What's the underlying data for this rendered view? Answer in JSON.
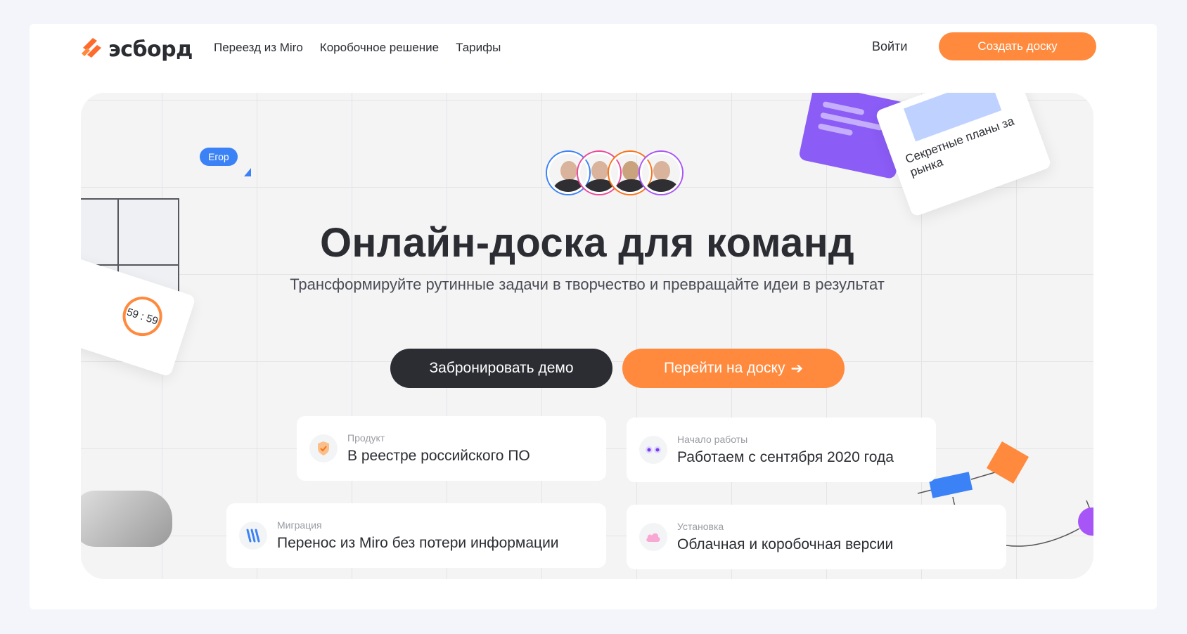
{
  "header": {
    "logo_text": "эсборд",
    "nav": [
      "Переезд из Miro",
      "Коробочное решение",
      "Тарифы"
    ],
    "login": "Войти",
    "create_board": "Создать доску"
  },
  "hero": {
    "title": "Онлайн-доска для команд",
    "subtitle": "Трансформируйте рутинные задачи в творчество и превращайте идеи в результат",
    "btn_demo": "Забронировать демо",
    "btn_board": "Перейти на доску",
    "btn_board_arrow": "➔",
    "avatar_rings": [
      "#3b82f6",
      "#ec4899",
      "#f97316",
      "#a855f7"
    ]
  },
  "cards": [
    {
      "label": "Продукт",
      "value": "В реестре российского ПО",
      "icon": "shield-check-icon",
      "color": "#f97316"
    },
    {
      "label": "Начало работы",
      "value": "Работаем с сентября 2020 года",
      "icon": "eyes-icon",
      "color": "#8b5cf6"
    },
    {
      "label": "Миграция",
      "value": "Перенос из Miro без потери информации",
      "icon": "miro-icon",
      "color": "#3b82f6"
    },
    {
      "label": "Установка",
      "value": "Облачная и коробочная версии",
      "icon": "cloud-icon",
      "color": "#ec4899"
    }
  ],
  "decor": {
    "cursor_name": "Егор",
    "timer_value": "59 : 59",
    "secret_title": "Секретные планы за рынка"
  },
  "colors": {
    "accent": "#ff8a3d",
    "dark": "#2b2d33"
  }
}
